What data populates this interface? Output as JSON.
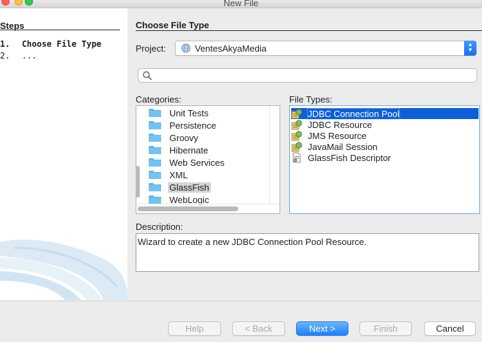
{
  "window": {
    "title": "New File"
  },
  "steps": {
    "heading": "Steps",
    "items": [
      {
        "number": "1.",
        "label": "Choose File Type"
      },
      {
        "number": "2.",
        "label": "..."
      }
    ]
  },
  "main": {
    "title": "Choose File Type",
    "project": {
      "label": "Project:",
      "value": "VentesAkyaMedia"
    },
    "search": {
      "value": "",
      "placeholder": ""
    },
    "categories": {
      "label": "Categories:",
      "items": [
        "Unit Tests",
        "Persistence",
        "Groovy",
        "Hibernate",
        "Web Services",
        "XML",
        "GlassFish",
        "WebLogic"
      ],
      "selected": "GlassFish"
    },
    "file_types": {
      "label": "File Types:",
      "items": [
        "JDBC Connection Pool",
        "JDBC Resource",
        "JMS Resource",
        "JavaMail Session",
        "GlassFish Descriptor"
      ],
      "selected": "JDBC Connection Pool"
    },
    "description": {
      "label": "Description:",
      "text": "Wizard to create a new JDBC Connection Pool Resource."
    }
  },
  "buttons": {
    "help": "Help",
    "back": "< Back",
    "next": "Next >",
    "finish": "Finish",
    "cancel": "Cancel"
  },
  "colors": {
    "selection": "#0d5fd9",
    "primary_button": "#1a82fb",
    "folder": "#5eb4ec"
  }
}
